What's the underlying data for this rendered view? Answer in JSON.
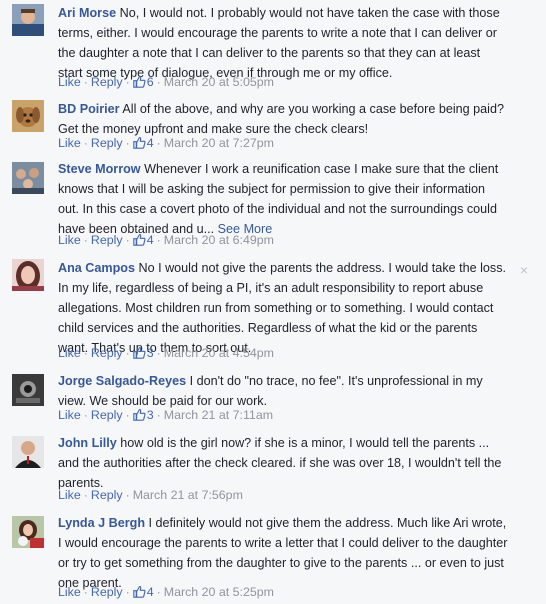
{
  "comments": [
    {
      "name": "Ari Morse",
      "text": "No, I would not. I probably would not have taken the case with those terms, either. I would encourage the parents to write a note that I can deliver or the daughter a note that I can deliver to the parents so that they can at least start some type of dialogue, even if through me or my office.",
      "like": "Like",
      "reply": "Reply",
      "likes": "6",
      "time": "March 20 at 5:05pm"
    },
    {
      "name": "BD Poirier",
      "text": "All of the above, and why are you working a case before being paid? Get the money upfront and make sure the check clears!",
      "like": "Like",
      "reply": "Reply",
      "likes": "4",
      "time": "March 20 at 7:27pm"
    },
    {
      "name": "Steve Morrow",
      "text": "Whenever I work a reunification case I make sure that the client knows that I will be asking the subject for permission to give their information out. In this case a covert photo of the individual and not the surroundings could have been obtained and u...",
      "see_more": "See More",
      "like": "Like",
      "reply": "Reply",
      "likes": "4",
      "time": "March 20 at 6:49pm"
    },
    {
      "name": "Ana Campos",
      "text": "No I would not give the parents the address. I would take the loss. In my life, regardless of being a PI, it's an adult responsibility to report abuse allegations. Most children run from something or to something. I would contact child services and the authorities. Regardless of what the kid or the parents want. That's up to them to sort out.",
      "like": "Like",
      "reply": "Reply",
      "likes": "3",
      "time": "March 20 at 4:54pm"
    },
    {
      "name": "Jorge Salgado-Reyes",
      "text": "I don't do \"no trace, no fee\". It's unprofessional in my view. We should be paid for our work.",
      "like": "Like",
      "reply": "Reply",
      "likes": "3",
      "time": "March 21 at 7:11am"
    },
    {
      "name": "John Lilly",
      "text": "how old is the girl now? if she is a minor, I would tell the parents ... and the authorities after the check cleared. if she was over 18, I wouldn't tell the parents.",
      "like": "Like",
      "reply": "Reply",
      "time": "March 21 at 7:56pm"
    },
    {
      "name": "Lynda J Bergh",
      "text": "I definitely would not give them the address. Much like Ari wrote, I would encourage the parents to write a letter that I could deliver to the daughter or try to get something from the daughter to give to the parents ... or even to just one parent.",
      "like": "Like",
      "reply": "Reply",
      "likes": "4",
      "time": "March 20 at 5:25pm"
    }
  ],
  "close_glyph": "×",
  "separator": "·",
  "colors": {
    "link": "#365899",
    "action": "#4267b2",
    "meta": "#90949c",
    "background": "#f6f7f9",
    "text": "#1d2129"
  }
}
